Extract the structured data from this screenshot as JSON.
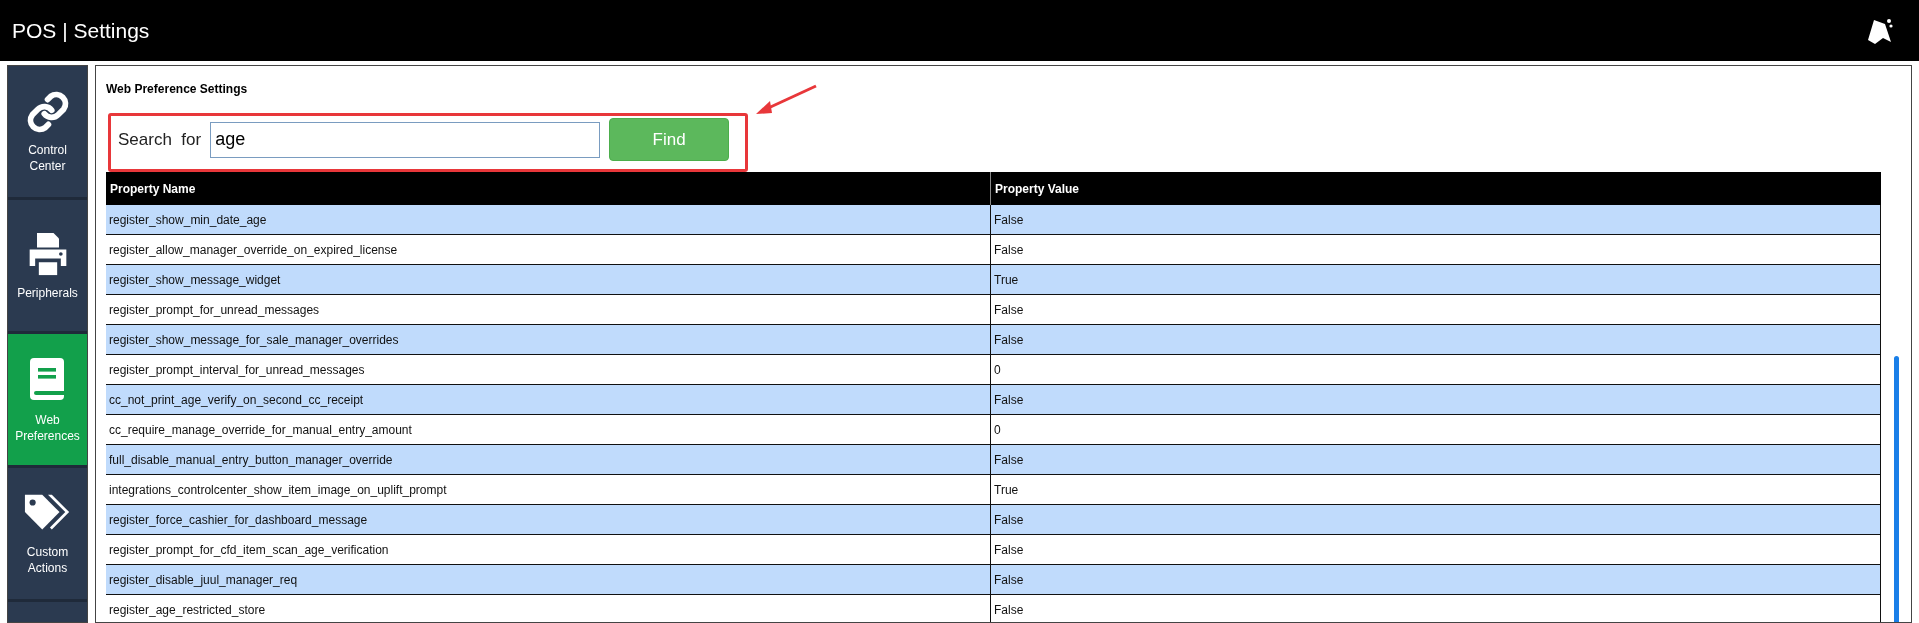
{
  "window": {
    "title": "POS | Settings"
  },
  "sidebar": {
    "items": [
      {
        "label": "Control Center",
        "selected": false
      },
      {
        "label": "Peripherals",
        "selected": false
      },
      {
        "label": "Web Preferences",
        "selected": true
      },
      {
        "label": "Custom Actions",
        "selected": false
      }
    ]
  },
  "panel": {
    "title": "Web Preference Settings",
    "search": {
      "label": "Search  for",
      "value": "age",
      "button": "Find"
    },
    "table": {
      "columns": [
        "Property Name",
        "Property Value"
      ],
      "rows": [
        [
          "register_show_min_date_age",
          "False"
        ],
        [
          "register_allow_manager_override_on_expired_license",
          "False"
        ],
        [
          "register_show_message_widget",
          "True"
        ],
        [
          "register_prompt_for_unread_messages",
          "False"
        ],
        [
          "register_show_message_for_sale_manager_overrides",
          "False"
        ],
        [
          "register_prompt_interval_for_unread_messages",
          "0"
        ],
        [
          "cc_not_print_age_verify_on_second_cc_receipt",
          "False"
        ],
        [
          "cc_require_manage_override_for_manual_entry_amount",
          "0"
        ],
        [
          "full_disable_manual_entry_button_manager_override",
          "False"
        ],
        [
          "integrations_controlcenter_show_item_image_on_uplift_prompt",
          "True"
        ],
        [
          "register_force_cashier_for_dashboard_message",
          "False"
        ],
        [
          "register_prompt_for_cfd_item_scan_age_verification",
          "False"
        ],
        [
          "register_disable_juul_manager_req",
          "False"
        ],
        [
          "register_age_restricted_store",
          "False"
        ]
      ]
    }
  }
}
